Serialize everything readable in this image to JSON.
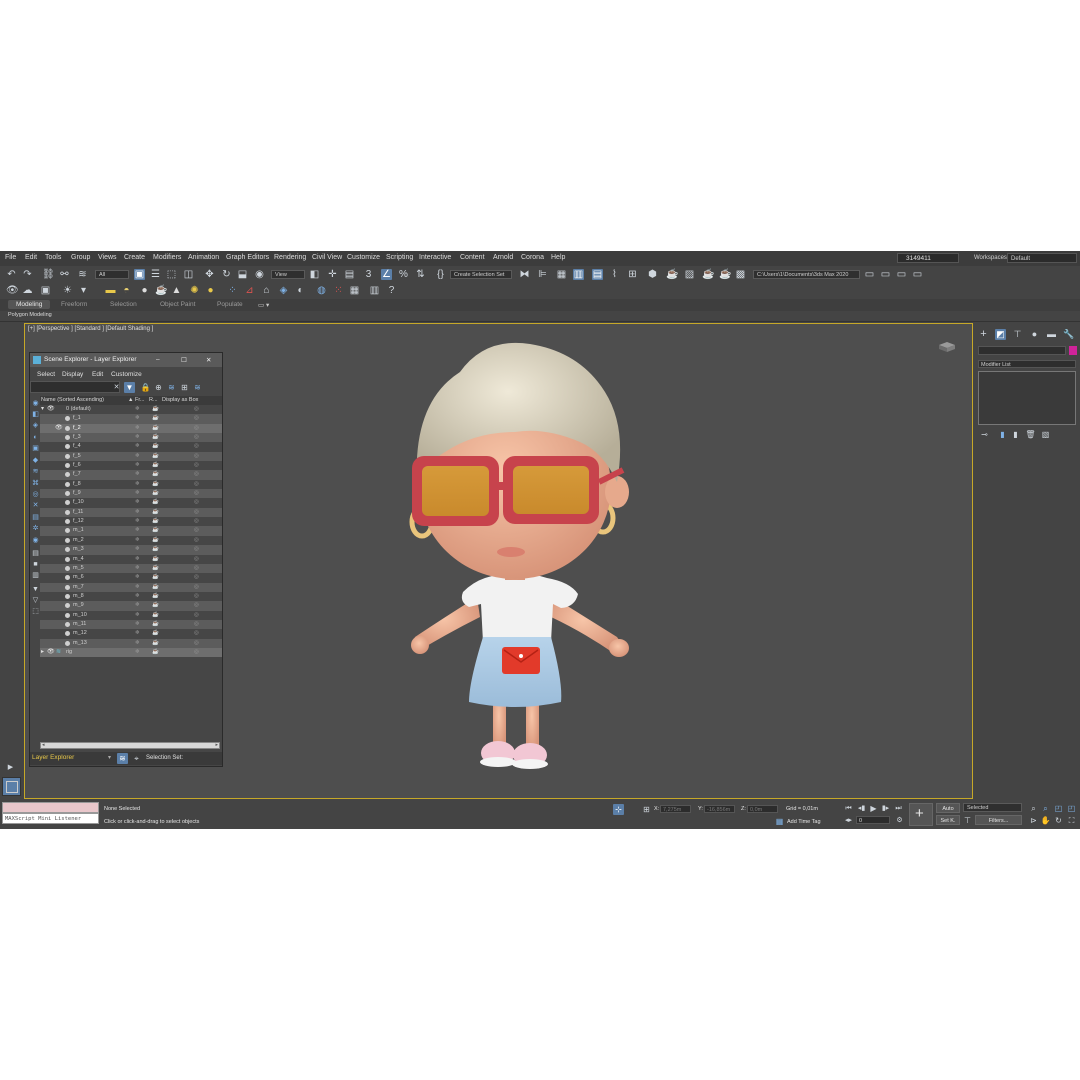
{
  "menu": [
    "File",
    "Edit",
    "Tools",
    "Group",
    "Views",
    "Create",
    "Modifiers",
    "Animation",
    "Graph Editors",
    "Rendering",
    "Civil View",
    "Customize",
    "Scripting",
    "Interactive",
    "Content",
    "Arnold",
    "Corona",
    "Help"
  ],
  "user": {
    "id": "3149411"
  },
  "workspaces": {
    "label": "Workspaces:",
    "value": "Default"
  },
  "toolbar": {
    "filter_value": "All",
    "view_value": "View",
    "selection_set_placeholder": "Create Selection Set",
    "path_value": "C:\\Users\\1\\Documents\\3ds Max 2020"
  },
  "ribbon": {
    "tabs": [
      "Modeling",
      "Freeform",
      "Selection",
      "Object Paint",
      "Populate"
    ],
    "sub_label": "Polygon Modeling"
  },
  "viewport": {
    "label": "[+] [Perspective ] [Standard ] [Default Shading ]"
  },
  "scene_explorer": {
    "title": "Scene Explorer - Layer Explorer",
    "menu": [
      "Select",
      "Display",
      "Edit",
      "Customize"
    ],
    "columns": [
      "Name (Sorted Ascending)",
      "▲ Fr...",
      "R...",
      "Display as Box"
    ],
    "rows": [
      {
        "name": "0 (default)",
        "indent": 0,
        "selected": false
      },
      {
        "name": "f_1",
        "indent": 1,
        "selected": false
      },
      {
        "name": "f_2",
        "indent": 1,
        "selected": true
      },
      {
        "name": "f_3",
        "indent": 1,
        "selected": false
      },
      {
        "name": "f_4",
        "indent": 1,
        "selected": false
      },
      {
        "name": "f_5",
        "indent": 1,
        "selected": false
      },
      {
        "name": "f_6",
        "indent": 1,
        "selected": false
      },
      {
        "name": "f_7",
        "indent": 1,
        "selected": false
      },
      {
        "name": "f_8",
        "indent": 1,
        "selected": false
      },
      {
        "name": "f_9",
        "indent": 1,
        "selected": false
      },
      {
        "name": "f_10",
        "indent": 1,
        "selected": false
      },
      {
        "name": "f_11",
        "indent": 1,
        "selected": false
      },
      {
        "name": "f_12",
        "indent": 1,
        "selected": false
      },
      {
        "name": "m_1",
        "indent": 1,
        "selected": false
      },
      {
        "name": "m_2",
        "indent": 1,
        "selected": false
      },
      {
        "name": "m_3",
        "indent": 1,
        "selected": false
      },
      {
        "name": "m_4",
        "indent": 1,
        "selected": false
      },
      {
        "name": "m_5",
        "indent": 1,
        "selected": false
      },
      {
        "name": "m_6",
        "indent": 1,
        "selected": false
      },
      {
        "name": "m_7",
        "indent": 1,
        "selected": false
      },
      {
        "name": "m_8",
        "indent": 1,
        "selected": false
      },
      {
        "name": "m_9",
        "indent": 1,
        "selected": false
      },
      {
        "name": "m_10",
        "indent": 1,
        "selected": false
      },
      {
        "name": "m_11",
        "indent": 1,
        "selected": false
      },
      {
        "name": "m_12",
        "indent": 1,
        "selected": false
      },
      {
        "name": "m_13",
        "indent": 1,
        "selected": false
      },
      {
        "name": "rig",
        "indent": 0,
        "selected": true
      }
    ],
    "footer_mode": "Layer Explorer",
    "selection_set_label": "Selection Set:"
  },
  "command_panel": {
    "modifier_list": "Modifier List"
  },
  "status": {
    "maxscript_label": "MAXScript Mini Listener",
    "selection": "None Selected",
    "prompt": "Click or click-and-drag to select objects",
    "x_label": "X:",
    "x_value": "7,275m",
    "y_label": "Y:",
    "y_value": "-16,856m",
    "z_label": "Z:",
    "z_value": "0,0m",
    "grid": "Grid = 0,01m",
    "add_time_tag": "Add Time Tag",
    "auto": "Auto",
    "set_key": "Set K.",
    "key_mode": "Selected",
    "filters": "Filters...",
    "frame": "0"
  },
  "colors": {
    "accent": "#5b7fa8",
    "viewport_border": "#c6a828",
    "layer_explorer_label": "#e8c84a"
  }
}
